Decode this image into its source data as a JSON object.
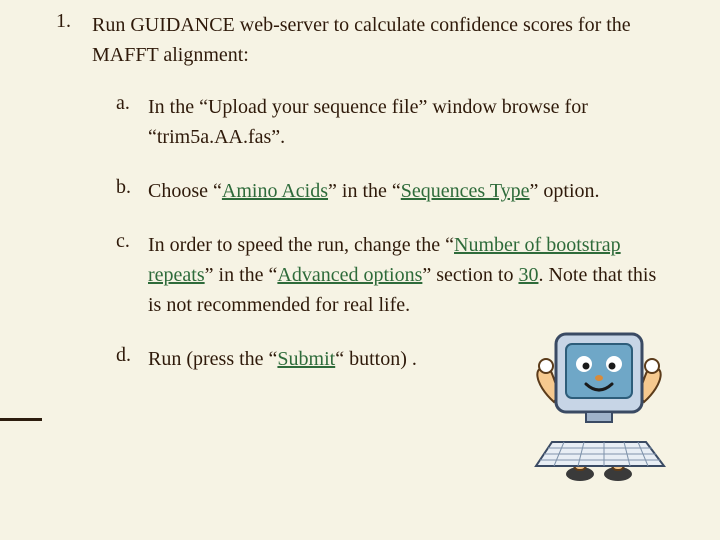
{
  "list": {
    "num1": "1.",
    "step1_a": "Run GUIDANCE web-server to calculate confidence scores for the MAFFT alignment:",
    "letA": "a.",
    "subA_1": "In the “Upload your sequence file” window browse for “trim5a.AA.fas”.",
    "letB": "b.",
    "subB_pre": "Choose “",
    "subB_kw1": "Amino Acids",
    "subB_mid": "” in the “",
    "subB_kw2": "Sequences Type",
    "subB_post": "” option.",
    "letC": "c.",
    "subC_pre": "In order to speed the run, change the “",
    "subC_kw1": "Number of bootstrap repeats",
    "subC_mid1": "” in the “",
    "subC_kw2": "Advanced options",
    "subC_mid2": "” section to ",
    "subC_kw3": "30",
    "subC_post": ". Note that this is not recommended for real life.",
    "letD": "d.",
    "subD_pre": "Run (press the “",
    "subD_kw1": "Submit",
    "subD_post": "“ button) ."
  },
  "clipart": {
    "name": "computer-mascot"
  }
}
